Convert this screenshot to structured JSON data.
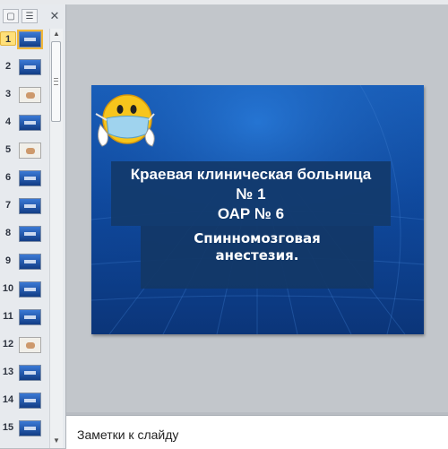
{
  "panel": {
    "close_glyph": "✕",
    "slide_numbers": [
      "1",
      "2",
      "3",
      "4",
      "5",
      "6",
      "7",
      "8",
      "9",
      "10",
      "11",
      "12",
      "13",
      "14",
      "15"
    ],
    "active_slide": 1
  },
  "slide": {
    "title_lines": [
      "Краевая клиническая больница",
      "№ 1",
      "ОАР № 6"
    ],
    "subtitle_lines": [
      "Спинномозговая",
      "анестезия."
    ]
  },
  "notes": {
    "placeholder": "Заметки к слайду"
  },
  "icons": {
    "tab_slides": "slides-tab-icon",
    "tab_outline": "outline-tab-icon",
    "emoji": "masked-smiley-icon"
  }
}
